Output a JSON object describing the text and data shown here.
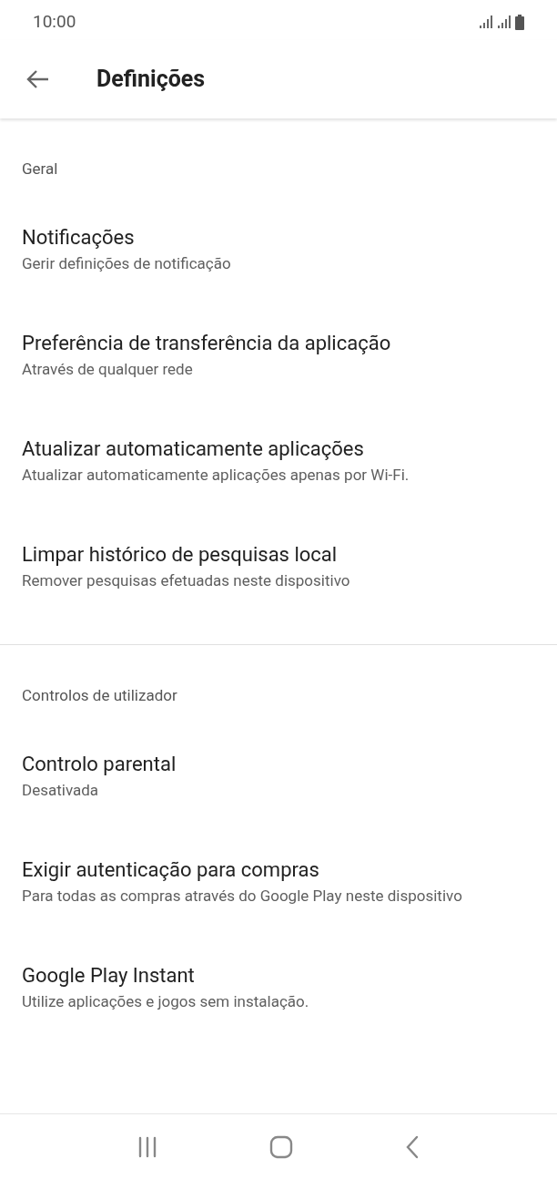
{
  "status_bar": {
    "time": "10:00"
  },
  "app_bar": {
    "title": "Definições"
  },
  "sections": [
    {
      "title": "Geral",
      "items": [
        {
          "title": "Notificações",
          "subtitle": "Gerir definições de notificação"
        },
        {
          "title": "Preferência de transferência da aplicação",
          "subtitle": "Através de qualquer rede"
        },
        {
          "title": "Atualizar automaticamente aplicações",
          "subtitle": "Atualizar automaticamente aplicações apenas por Wi-Fi."
        },
        {
          "title": "Limpar histórico de pesquisas local",
          "subtitle": "Remover pesquisas efetuadas neste dispositivo"
        }
      ]
    },
    {
      "title": "Controlos de utilizador",
      "items": [
        {
          "title": "Controlo parental",
          "subtitle": "Desativada"
        },
        {
          "title": "Exigir autenticação para compras",
          "subtitle": "Para todas as compras através do Google Play neste dispositivo"
        },
        {
          "title": "Google Play Instant",
          "subtitle": "Utilize aplicações e jogos sem instalação."
        }
      ]
    }
  ]
}
